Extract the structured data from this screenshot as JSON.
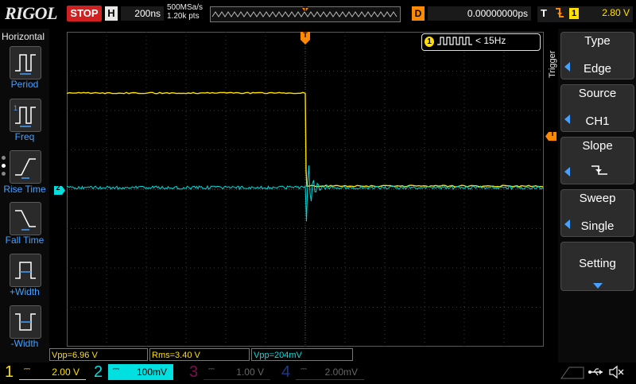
{
  "top": {
    "brand": "RIGOL",
    "run_state": "STOP",
    "timebase_label": "H",
    "timebase_value": "200ns",
    "sample_rate": "500MSa/s",
    "memory_depth": "1.20k pts",
    "delay_label": "D",
    "delay_value": "0.00000000ps",
    "trigger_label": "T",
    "trigger_source_num": "1",
    "trigger_level": "2.80 V",
    "trigger_marker": "T"
  },
  "left_panel": {
    "title": "Horizontal",
    "measures": [
      {
        "label": "Period"
      },
      {
        "label": "Freq"
      },
      {
        "label": "Rise Time"
      },
      {
        "label": "Fall Time"
      },
      {
        "label": "+Width"
      },
      {
        "label": "-Width"
      }
    ]
  },
  "trigger_freq": {
    "channel": "1",
    "text": "< 15Hz"
  },
  "right_panel": {
    "section": "Trigger",
    "menu": [
      {
        "title": "Type",
        "value": "Edge"
      },
      {
        "title": "Source",
        "value": "CH1"
      },
      {
        "title": "Slope",
        "value": ""
      },
      {
        "title": "Sweep",
        "value": "Single"
      },
      {
        "title": "Setting",
        "value": ""
      }
    ]
  },
  "markers": {
    "ch2": "2",
    "trig_right": "T"
  },
  "measurements": [
    {
      "text": "Vpp=6.96 V",
      "color": "#ffe000"
    },
    {
      "text": "Rms=3.40 V",
      "color": "#ffe000"
    },
    {
      "text": "Vpp=204mV",
      "color": "#00e0e0"
    }
  ],
  "channels": [
    {
      "num": "1",
      "scale": "2.00 V",
      "color": "#ffe000",
      "active": true
    },
    {
      "num": "2",
      "scale": "100mV",
      "color": "#00e0e0",
      "active": true
    },
    {
      "num": "3",
      "scale": "1.00 V",
      "color": "#c0007a",
      "active": false
    },
    {
      "num": "4",
      "scale": "2.00mV",
      "color": "#2060ff",
      "active": false
    }
  ],
  "colors": {
    "accent": "#46a0ff",
    "ch1": "#ffe000",
    "ch2": "#00e0e0",
    "trigger": "#ff8a00",
    "stop": "#d02020"
  }
}
